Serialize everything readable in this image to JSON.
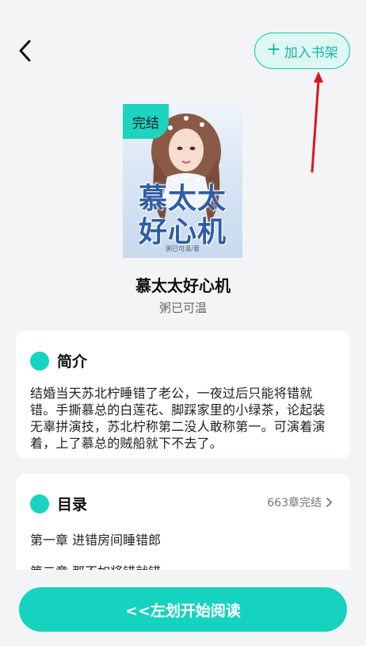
{
  "header": {
    "back_icon": "chevron-left-icon",
    "shelf_plus": "+",
    "shelf_label": "加入书架"
  },
  "book": {
    "cover_badge": "完结",
    "cover_title": "慕太太好心机",
    "cover_author": "粥已可温/著",
    "title": "慕太太好心机",
    "author": "粥已可温"
  },
  "intro": {
    "heading": "简介",
    "text": "结婚当天苏北柠睡错了老公，一夜过后只能将错就错。手撕慕总的白莲花、脚踩家里的小绿茶，论起装无辜拼演技，苏北柠称第二没人敢称第一。可演着演着，上了慕总的贼船就下不去了。"
  },
  "toc": {
    "heading": "目录",
    "status": "663章完结",
    "chapters": [
      "第一章 进错房间睡错郎",
      "第二章 那不如将错就错"
    ]
  },
  "footer": {
    "read_label": "<<左划开始阅读"
  },
  "colors": {
    "accent": "#16d3bf",
    "annotation_arrow": "#e0141e"
  }
}
